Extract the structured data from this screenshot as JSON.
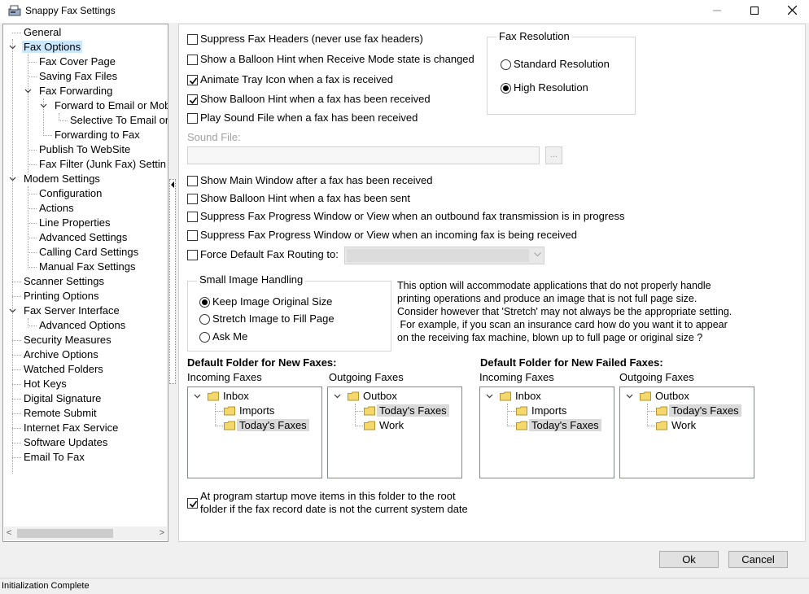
{
  "window": {
    "title": "Snappy Fax Settings",
    "minimize": "─",
    "maximize": "☐",
    "close": "✕"
  },
  "tree": {
    "items": [
      {
        "label": "General"
      },
      {
        "label": "Fax Options"
      },
      {
        "label": "Fax Cover Page"
      },
      {
        "label": "Saving Fax Files"
      },
      {
        "label": "Fax Forwarding"
      },
      {
        "label": "Forward to Email or Mob"
      },
      {
        "label": "Selective To Email or"
      },
      {
        "label": "Forwarding to Fax"
      },
      {
        "label": "Publish To WebSite"
      },
      {
        "label": "Fax Filter (Junk Fax) Settin"
      },
      {
        "label": "Modem Settings"
      },
      {
        "label": "Configuration"
      },
      {
        "label": "Actions"
      },
      {
        "label": "Line Properties"
      },
      {
        "label": "Advanced Settings"
      },
      {
        "label": "Calling Card Settings"
      },
      {
        "label": "Manual Fax Settings"
      },
      {
        "label": "Scanner Settings"
      },
      {
        "label": "Printing Options"
      },
      {
        "label": "Fax Server Interface"
      },
      {
        "label": "Advanced Options"
      },
      {
        "label": "Security Measures"
      },
      {
        "label": "Archive Options"
      },
      {
        "label": "Watched Folders"
      },
      {
        "label": "Hot Keys"
      },
      {
        "label": "Digital Signature"
      },
      {
        "label": "Remote Submit"
      },
      {
        "label": "Internet Fax Service"
      },
      {
        "label": "Software Updates"
      },
      {
        "label": "Email To Fax"
      }
    ],
    "selected": "Fax Options",
    "scroll_left": "<",
    "scroll_right": ">"
  },
  "options": {
    "suppress_headers": {
      "label": "Suppress Fax Headers (never use fax headers)",
      "checked": false
    },
    "balloon_receive_mode": {
      "label": "Show a Balloon Hint when Receive Mode state is changed",
      "checked": false
    },
    "animate_tray": {
      "label": "Animate Tray Icon when a fax is received",
      "checked": true
    },
    "balloon_received": {
      "label": "Show Balloon Hint when a fax has been received",
      "checked": true
    },
    "play_sound": {
      "label": "Play Sound File when a fax has been received",
      "checked": false
    },
    "sound_file_label": "Sound File:",
    "sound_file_value": "",
    "browse_label": "...",
    "show_main_window": {
      "label": "Show Main Window after a fax has been received",
      "checked": false
    },
    "balloon_sent": {
      "label": "Show Balloon Hint when a fax has been sent",
      "checked": false
    },
    "suppress_outbound": {
      "label": "Suppress Fax Progress Window or View when an outbound fax transmission is in progress",
      "checked": false
    },
    "suppress_incoming": {
      "label": "Suppress Fax Progress Window or View when an incoming fax is being received",
      "checked": false
    },
    "force_routing": {
      "label": "Force Default Fax Routing to:",
      "checked": false
    },
    "routing_value": ""
  },
  "resolution": {
    "title": "Fax Resolution",
    "standard": "Standard Resolution",
    "high": "High Resolution",
    "selected": "high"
  },
  "small_image": {
    "title": "Small Image Handling",
    "keep": "Keep Image Original Size",
    "stretch": "Stretch Image to Fill Page",
    "ask": "Ask Me",
    "selected": "keep",
    "description": [
      "This option will accommodate applications that do not properly handle",
      "printing operations and produce an image that is not full page size.",
      "Consider however that 'Stretch' may not always be the appropriate setting.",
      " For example, if you scan an insurance card how do you want it to appear",
      "on the receiving fax machine, blown up to full page or original size ?"
    ]
  },
  "folders": {
    "new_title": "Default Folder for New Faxes:",
    "failed_title": "Default Folder for New Failed Faxes:",
    "incoming_label": "Incoming Faxes",
    "outgoing_label": "Outgoing Faxes",
    "inbox": "Inbox",
    "imports": "Imports",
    "todays": "Today's Faxes",
    "outbox": "Outbox",
    "work": "Work"
  },
  "startup": {
    "label_line1": "At program startup move items in this folder to the root",
    "label_line2": "folder if the fax record date is not the current system date",
    "checked": true
  },
  "buttons": {
    "ok": "Ok",
    "cancel": "Cancel"
  },
  "status": "Initialization Complete",
  "colors": {
    "selection": "#cce8ff",
    "highlight": "#d9d9d9",
    "folder": "#f5d86c"
  }
}
